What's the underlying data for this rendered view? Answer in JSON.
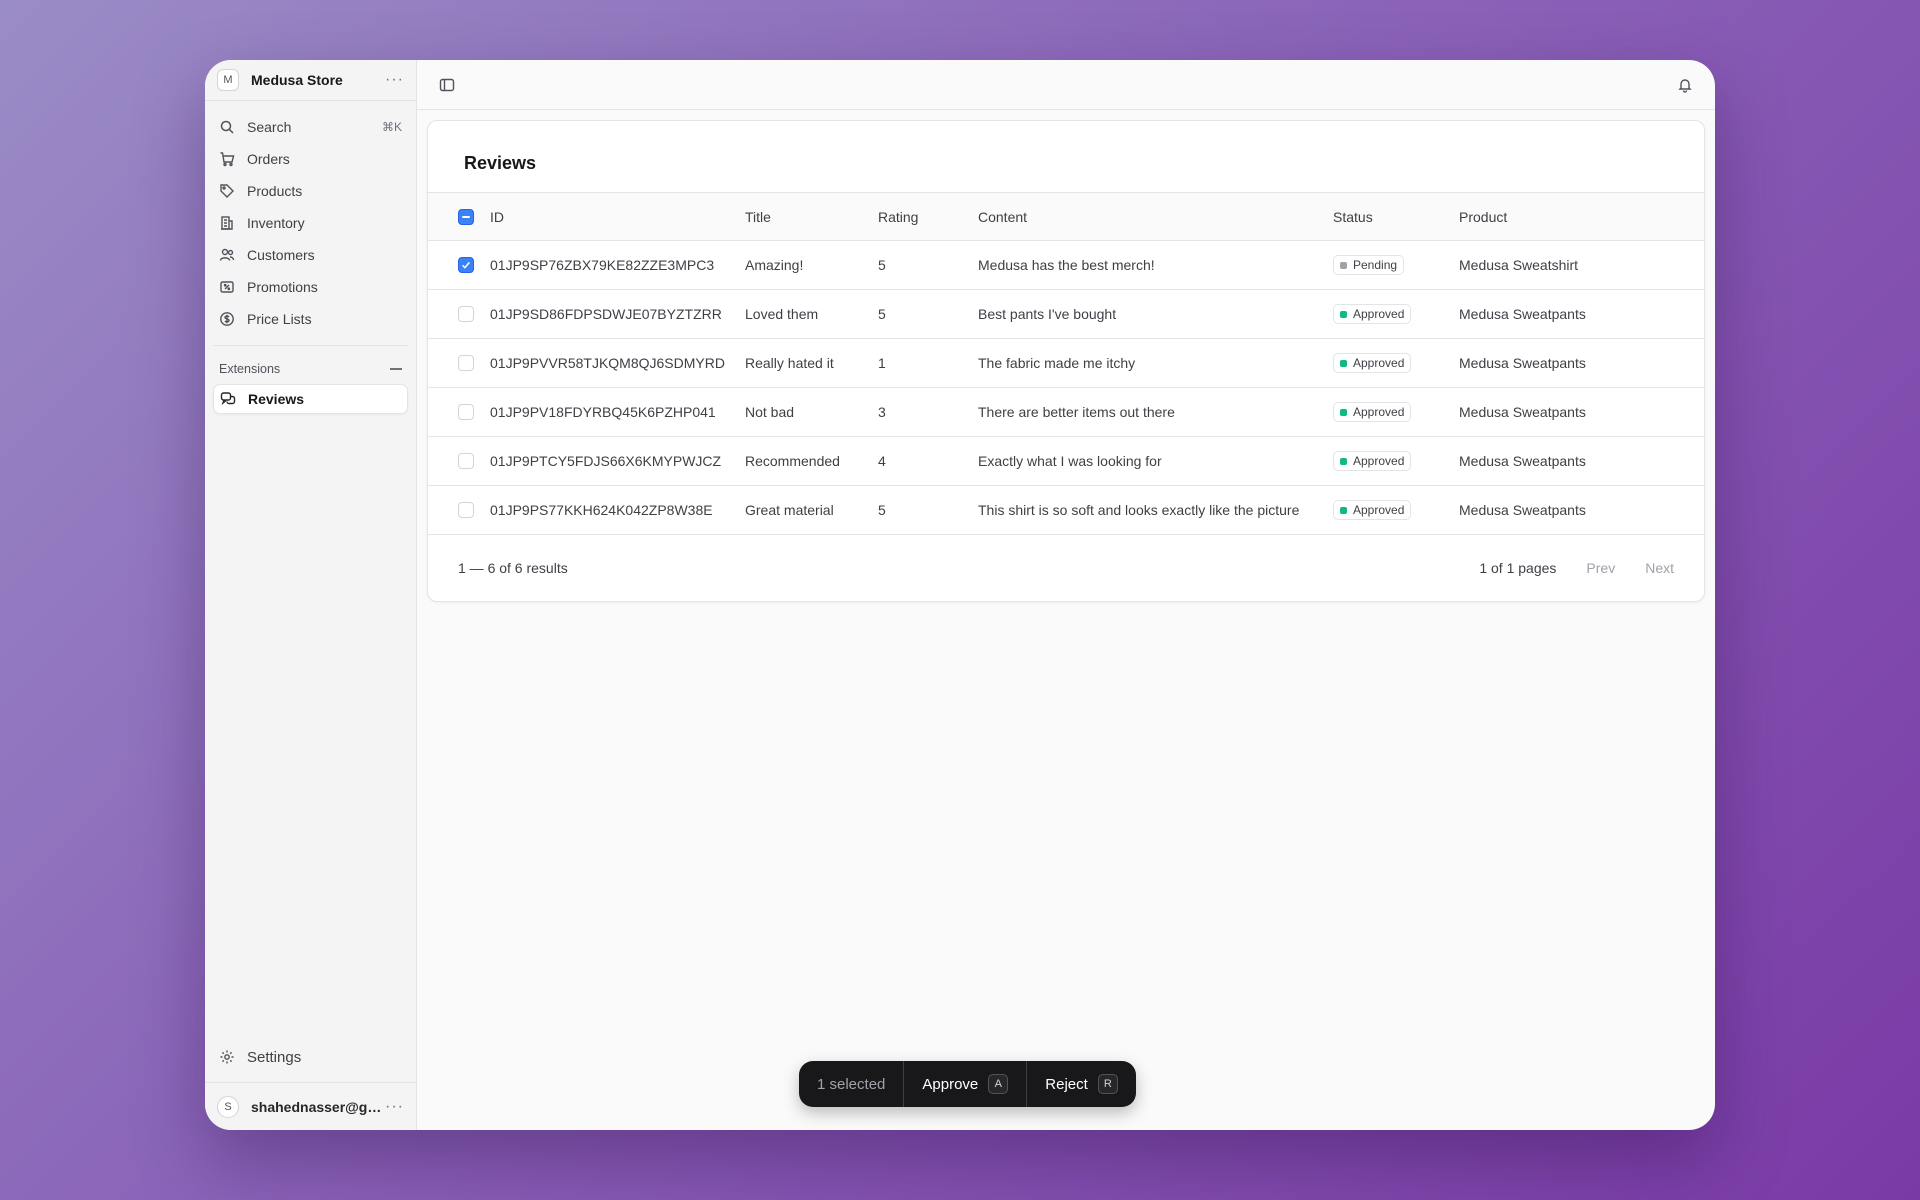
{
  "store": {
    "avatar": "M",
    "name": "Medusa Store"
  },
  "nav": {
    "search": {
      "label": "Search",
      "shortcut": "⌘K"
    },
    "items": [
      {
        "label": "Orders",
        "icon": "cart-icon"
      },
      {
        "label": "Products",
        "icon": "tag-icon"
      },
      {
        "label": "Inventory",
        "icon": "building-icon"
      },
      {
        "label": "Customers",
        "icon": "users-icon"
      },
      {
        "label": "Promotions",
        "icon": "receipt-percent-icon"
      },
      {
        "label": "Price Lists",
        "icon": "currency-dollar-icon"
      }
    ],
    "extensions_label": "Extensions",
    "reviews_label": "Reviews",
    "settings_label": "Settings"
  },
  "user": {
    "avatar": "S",
    "email": "shahednasser@gmai..."
  },
  "page": {
    "title": "Reviews",
    "columns": [
      "ID",
      "Title",
      "Rating",
      "Content",
      "Status",
      "Product"
    ],
    "rows": [
      {
        "id": "01JP9SP76ZBX79KE82ZZE3MPC3",
        "title": "Amazing!",
        "rating": "5",
        "content": "Medusa has the best merch!",
        "status": "Pending",
        "product": "Medusa Sweatshirt",
        "checked": true
      },
      {
        "id": "01JP9SD86FDPSDWJE07BYZTZRR",
        "title": "Loved them",
        "rating": "5",
        "content": "Best pants I've bought",
        "status": "Approved",
        "product": "Medusa Sweatpants",
        "checked": false
      },
      {
        "id": "01JP9PVVR58TJKQM8QJ6SDMYRD",
        "title": "Really hated it",
        "rating": "1",
        "content": "The fabric made me itchy",
        "status": "Approved",
        "product": "Medusa Sweatpants",
        "checked": false
      },
      {
        "id": "01JP9PV18FDYRBQ45K6PZHP041",
        "title": "Not bad",
        "rating": "3",
        "content": "There are better items out there",
        "status": "Approved",
        "product": "Medusa Sweatpants",
        "checked": false
      },
      {
        "id": "01JP9PTCY5FDJS66X6KMYPWJCZ",
        "title": "Recommended",
        "rating": "4",
        "content": "Exactly what I was looking for",
        "status": "Approved",
        "product": "Medusa Sweatpants",
        "checked": false
      },
      {
        "id": "01JP9PS77KKH624K042ZP8W38E",
        "title": "Great material",
        "rating": "5",
        "content": "This shirt is so soft and looks exactly like the picture",
        "status": "Approved",
        "product": "Medusa Sweatpants",
        "checked": false
      }
    ],
    "status_colors": {
      "Pending": "#a1a1aa",
      "Approved": "#10b981"
    },
    "pagination": {
      "range": "1 — 6 of 6 results",
      "pages": "1 of 1 pages",
      "prev": "Prev",
      "next": "Next"
    }
  },
  "command_bar": {
    "selected": "1 selected",
    "approve": {
      "label": "Approve",
      "shortcut": "A"
    },
    "reject": {
      "label": "Reject",
      "shortcut": "R"
    }
  },
  "colors": {
    "accent": "#3b82f6",
    "command_bar_bg": "#18181b"
  }
}
